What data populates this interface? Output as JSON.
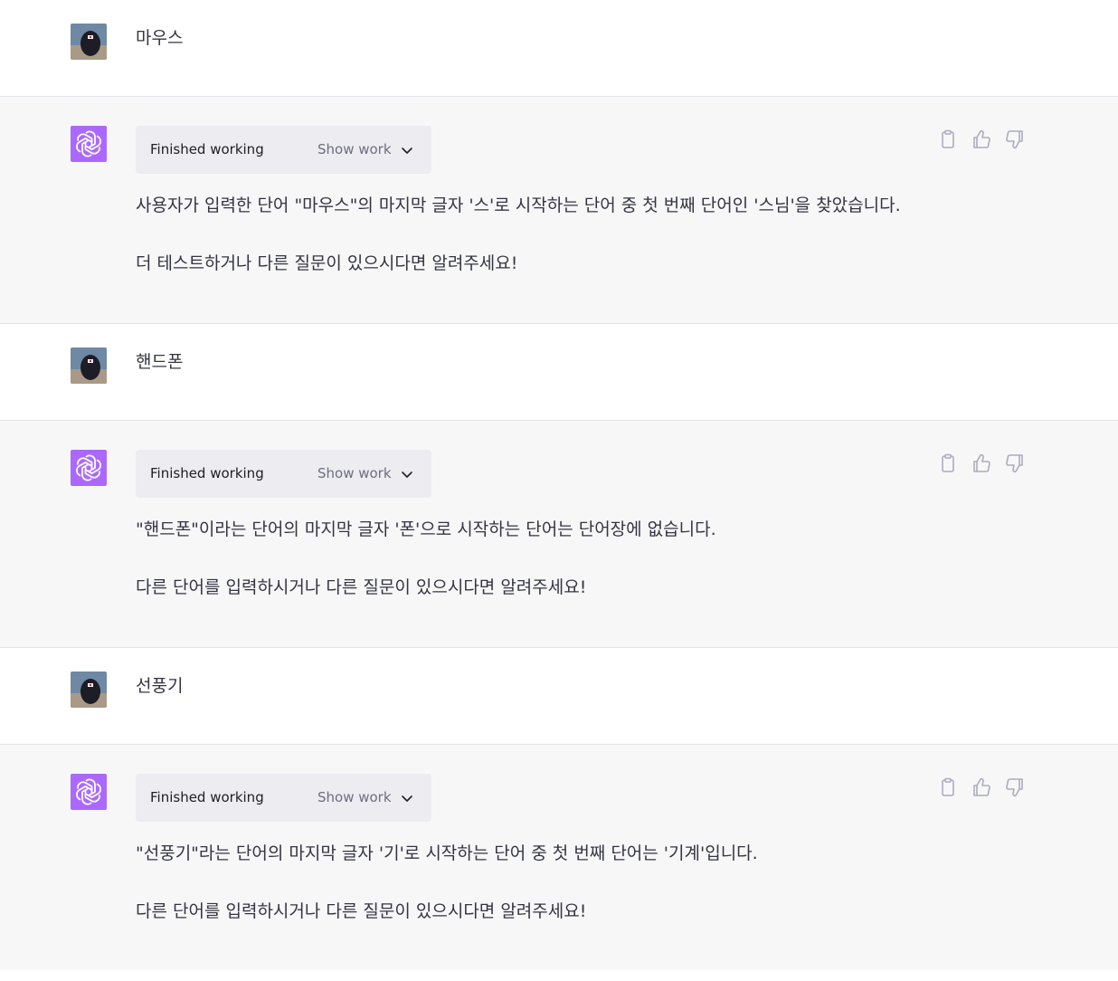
{
  "colors": {
    "bot_avatar": "#ab68ff",
    "bot_bg": "#f7f7f8",
    "work_box_bg": "#ececf1",
    "divider": "#e3e3e8"
  },
  "conversation": [
    {
      "role": "user",
      "text": "마우스"
    },
    {
      "role": "assistant",
      "work_status": "Finished working",
      "work_toggle": "Show work",
      "paragraphs": [
        "사용자가 입력한 단어 \"마우스\"의 마지막 글자 '스'로 시작하는 단어 중 첫 번째 단어인 '스님'을 찾았습니다.",
        "더 테스트하거나 다른 질문이 있으시다면 알려주세요!"
      ],
      "icons": [
        "clipboard-icon",
        "thumbs-up-icon",
        "thumbs-down-icon"
      ]
    },
    {
      "role": "user",
      "text": "핸드폰"
    },
    {
      "role": "assistant",
      "work_status": "Finished working",
      "work_toggle": "Show work",
      "paragraphs": [
        "\"핸드폰\"이라는 단어의 마지막 글자 '폰'으로 시작하는 단어는 단어장에 없습니다.",
        "다른 단어를 입력하시거나 다른 질문이 있으시다면 알려주세요!"
      ],
      "icons": [
        "clipboard-icon",
        "thumbs-up-icon",
        "thumbs-down-icon"
      ]
    },
    {
      "role": "user",
      "text": "선풍기"
    },
    {
      "role": "assistant",
      "work_status": "Finished working",
      "work_toggle": "Show work",
      "paragraphs": [
        "\"선풍기\"라는 단어의 마지막 글자 '기'로 시작하는 단어 중 첫 번째 단어는 '기계'입니다.",
        "다른 단어를 입력하시거나 다른 질문이 있으시다면 알려주세요!"
      ],
      "icons": [
        "clipboard-icon",
        "thumbs-up-icon",
        "thumbs-down-icon"
      ]
    }
  ]
}
